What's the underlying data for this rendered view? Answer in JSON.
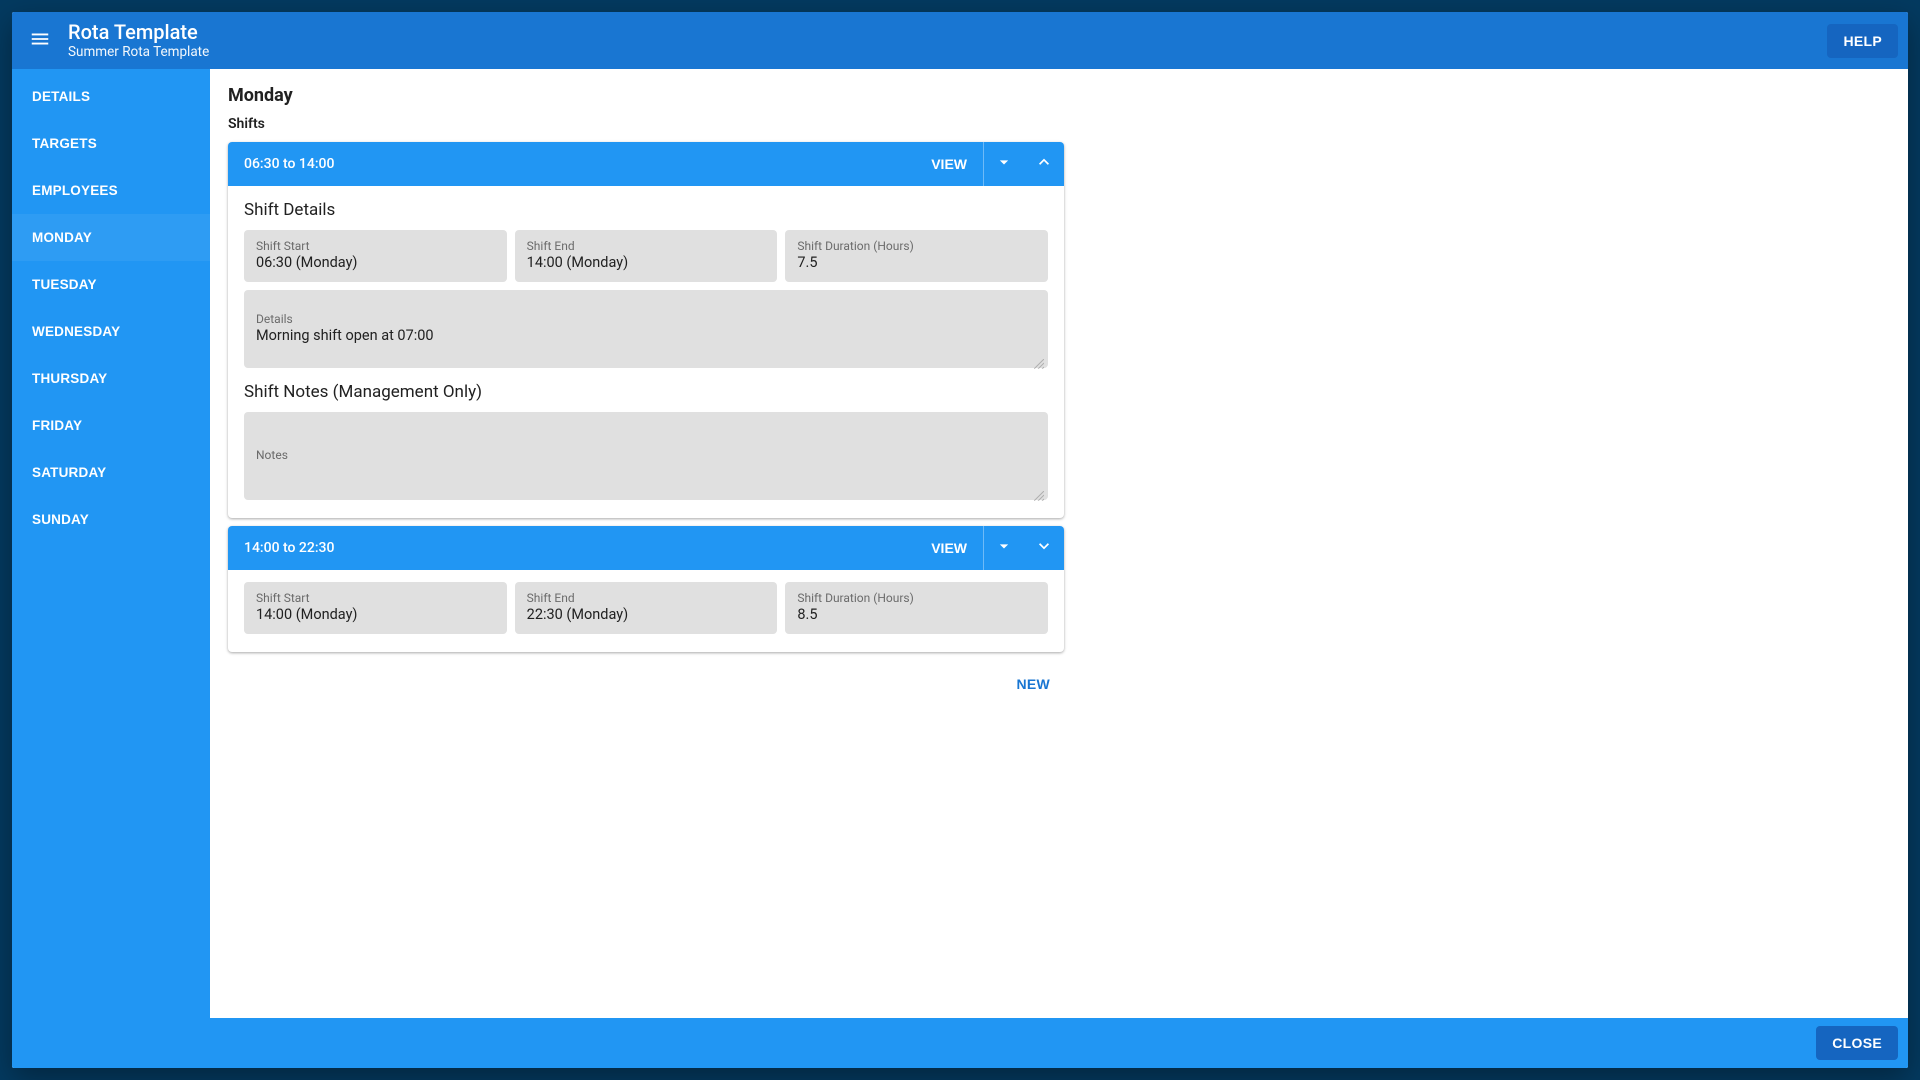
{
  "header": {
    "title": "Rota Template",
    "subtitle": "Summer Rota Template",
    "help_label": "HELP"
  },
  "sidebar": {
    "items": [
      {
        "label": "DETAILS"
      },
      {
        "label": "TARGETS"
      },
      {
        "label": "EMPLOYEES"
      },
      {
        "label": "MONDAY"
      },
      {
        "label": "TUESDAY"
      },
      {
        "label": "WEDNESDAY"
      },
      {
        "label": "THURSDAY"
      },
      {
        "label": "FRIDAY"
      },
      {
        "label": "SATURDAY"
      },
      {
        "label": "SUNDAY"
      }
    ],
    "active_index": 3
  },
  "main": {
    "heading": "Monday",
    "shifts_label": "Shifts",
    "view_label": "VIEW",
    "shift_details_title": "Shift Details",
    "shift_notes_title": "Shift Notes (Management Only)",
    "field_labels": {
      "shift_start": "Shift Start",
      "shift_end": "Shift End",
      "shift_duration": "Shift Duration (Hours)",
      "details": "Details",
      "notes": "Notes"
    },
    "shifts": [
      {
        "range": "06:30 to 14:00",
        "expanded": true,
        "start": "06:30 (Monday)",
        "end": "14:00 (Monday)",
        "duration": "7.5",
        "details": "Morning shift open at 07:00",
        "notes": ""
      },
      {
        "range": "14:00 to 22:30",
        "expanded": false,
        "start": "14:00 (Monday)",
        "end": "22:30 (Monday)",
        "duration": "8.5"
      }
    ],
    "new_label": "NEW"
  },
  "footer": {
    "close_label": "CLOSE"
  }
}
